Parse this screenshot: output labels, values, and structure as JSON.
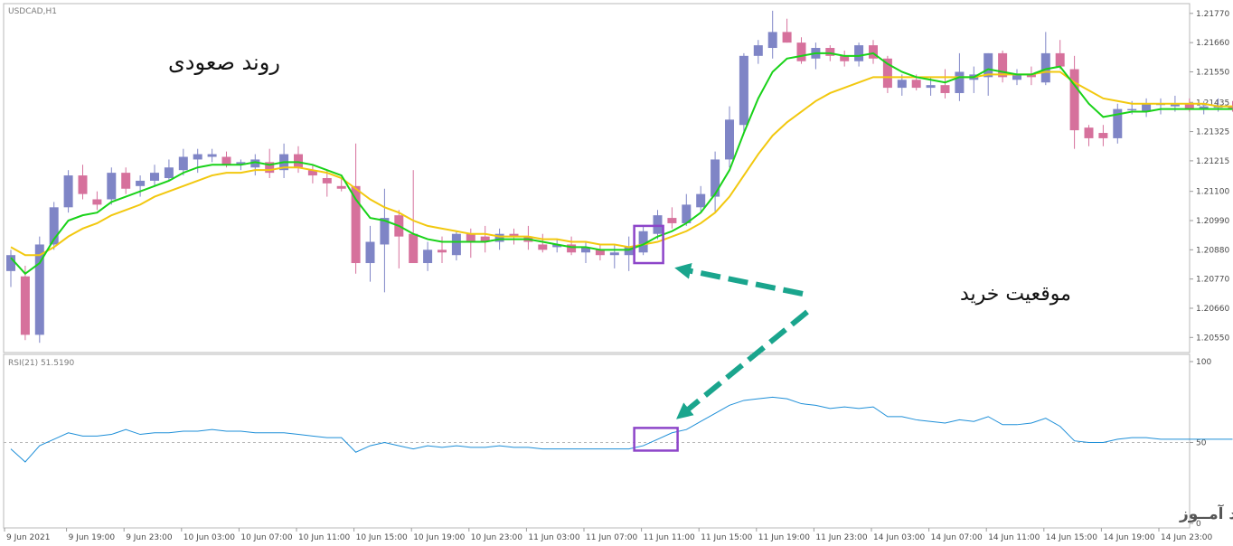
{
  "main_chart": {
    "symbol_label": "USDCAD,H1",
    "price_ticks": [
      "1.21770",
      "1.21660",
      "1.21550",
      "1.21435",
      "1.21325",
      "1.21215",
      "1.21100",
      "1.20990",
      "1.20880",
      "1.20770",
      "1.20660",
      "1.20550"
    ],
    "annotation_trend": "روند صعودی",
    "annotation_buy": "موقعیت خرید"
  },
  "rsi_panel": {
    "label": "RSI(21) 51.5190",
    "ticks": [
      "100",
      "50",
      "0"
    ]
  },
  "time_ticks": [
    "9 Jun 2021",
    "9 Jun 19:00",
    "9 Jun 23:00",
    "10 Jun 03:00",
    "10 Jun 07:00",
    "10 Jun 11:00",
    "10 Jun 15:00",
    "10 Jun 19:00",
    "10 Jun 23:00",
    "11 Jun 03:00",
    "11 Jun 07:00",
    "11 Jun 11:00",
    "11 Jun 15:00",
    "11 Jun 19:00",
    "11 Jun 23:00",
    "14 Jun 03:00",
    "14 Jun 07:00",
    "14 Jun 11:00",
    "14 Jun 15:00",
    "14 Jun 19:00",
    "14 Jun 23:00"
  ],
  "watermark": "انتشار در وبسایت ســود آمــوز",
  "colors": {
    "bull": "#7f85c6",
    "bear": "#d6719c",
    "ma_fast": "#19d219",
    "ma_slow": "#f2c80f",
    "rsi": "#1e8fd8",
    "highlight": "#8d45c9",
    "arrow": "#1aa58d"
  },
  "chart_data": {
    "type": "candlestick",
    "symbol": "USDCAD",
    "timeframe": "H1",
    "ylim": [
      1.205,
      1.218
    ],
    "candles": [
      {
        "o": 1.208,
        "h": 1.2088,
        "l": 1.2074,
        "c": 1.2086
      },
      {
        "o": 1.2078,
        "h": 1.2082,
        "l": 1.2054,
        "c": 1.2056
      },
      {
        "o": 1.2056,
        "h": 1.2093,
        "l": 1.2053,
        "c": 1.209
      },
      {
        "o": 1.209,
        "h": 1.2106,
        "l": 1.2088,
        "c": 1.2104
      },
      {
        "o": 1.2104,
        "h": 1.2118,
        "l": 1.2102,
        "c": 1.2116
      },
      {
        "o": 1.2116,
        "h": 1.212,
        "l": 1.2107,
        "c": 1.2109
      },
      {
        "o": 1.2107,
        "h": 1.211,
        "l": 1.2103,
        "c": 1.2105
      },
      {
        "o": 1.2107,
        "h": 1.2119,
        "l": 1.2105,
        "c": 1.2117
      },
      {
        "o": 1.2117,
        "h": 1.2119,
        "l": 1.2109,
        "c": 1.2111
      },
      {
        "o": 1.2112,
        "h": 1.2116,
        "l": 1.2108,
        "c": 1.2114
      },
      {
        "o": 1.2114,
        "h": 1.212,
        "l": 1.2112,
        "c": 1.2117
      },
      {
        "o": 1.2115,
        "h": 1.2122,
        "l": 1.2114,
        "c": 1.2119
      },
      {
        "o": 1.2118,
        "h": 1.2126,
        "l": 1.2116,
        "c": 1.2123
      },
      {
        "o": 1.2122,
        "h": 1.2126,
        "l": 1.2117,
        "c": 1.2124
      },
      {
        "o": 1.2123,
        "h": 1.2126,
        "l": 1.2121,
        "c": 1.2124
      },
      {
        "o": 1.2123,
        "h": 1.2125,
        "l": 1.2119,
        "c": 1.212
      },
      {
        "o": 1.212,
        "h": 1.2122,
        "l": 1.2118,
        "c": 1.2121
      },
      {
        "o": 1.2119,
        "h": 1.2124,
        "l": 1.2116,
        "c": 1.2122
      },
      {
        "o": 1.2121,
        "h": 1.2126,
        "l": 1.2115,
        "c": 1.2117
      },
      {
        "o": 1.2118,
        "h": 1.2128,
        "l": 1.2115,
        "c": 1.2124
      },
      {
        "o": 1.2124,
        "h": 1.2127,
        "l": 1.2117,
        "c": 1.2119
      },
      {
        "o": 1.2118,
        "h": 1.212,
        "l": 1.2113,
        "c": 1.2116
      },
      {
        "o": 1.2115,
        "h": 1.2118,
        "l": 1.2108,
        "c": 1.2113
      },
      {
        "o": 1.2112,
        "h": 1.2115,
        "l": 1.211,
        "c": 1.2111
      },
      {
        "o": 1.2112,
        "h": 1.2128,
        "l": 1.2079,
        "c": 1.2083
      },
      {
        "o": 1.2083,
        "h": 1.2097,
        "l": 1.2076,
        "c": 1.2091
      },
      {
        "o": 1.209,
        "h": 1.2111,
        "l": 1.2072,
        "c": 1.21
      },
      {
        "o": 1.2101,
        "h": 1.2103,
        "l": 1.2081,
        "c": 1.2093
      },
      {
        "o": 1.2094,
        "h": 1.2118,
        "l": 1.2085,
        "c": 1.2083
      },
      {
        "o": 1.2083,
        "h": 1.2091,
        "l": 1.208,
        "c": 1.2088
      },
      {
        "o": 1.2088,
        "h": 1.2093,
        "l": 1.2083,
        "c": 1.2087
      },
      {
        "o": 1.2086,
        "h": 1.2095,
        "l": 1.2084,
        "c": 1.2094
      },
      {
        "o": 1.2094,
        "h": 1.2096,
        "l": 1.2085,
        "c": 1.2091
      },
      {
        "o": 1.2093,
        "h": 1.2097,
        "l": 1.2087,
        "c": 1.2091
      },
      {
        "o": 1.2091,
        "h": 1.2096,
        "l": 1.2088,
        "c": 1.2094
      },
      {
        "o": 1.2094,
        "h": 1.2096,
        "l": 1.209,
        "c": 1.2093
      },
      {
        "o": 1.2093,
        "h": 1.2097,
        "l": 1.2088,
        "c": 1.2091
      },
      {
        "o": 1.209,
        "h": 1.2094,
        "l": 1.2087,
        "c": 1.2088
      },
      {
        "o": 1.2089,
        "h": 1.2092,
        "l": 1.2087,
        "c": 1.209
      },
      {
        "o": 1.209,
        "h": 1.2093,
        "l": 1.2086,
        "c": 1.2087
      },
      {
        "o": 1.2087,
        "h": 1.2091,
        "l": 1.2083,
        "c": 1.2089
      },
      {
        "o": 1.2088,
        "h": 1.209,
        "l": 1.2084,
        "c": 1.2086
      },
      {
        "o": 1.2086,
        "h": 1.209,
        "l": 1.2081,
        "c": 1.2087
      },
      {
        "o": 1.2086,
        "h": 1.2093,
        "l": 1.208,
        "c": 1.2089
      },
      {
        "o": 1.2087,
        "h": 1.2097,
        "l": 1.2086,
        "c": 1.2095
      },
      {
        "o": 1.2094,
        "h": 1.2103,
        "l": 1.2092,
        "c": 1.2101
      },
      {
        "o": 1.21,
        "h": 1.2104,
        "l": 1.2096,
        "c": 1.2098
      },
      {
        "o": 1.2098,
        "h": 1.2109,
        "l": 1.2097,
        "c": 1.2105
      },
      {
        "o": 1.2104,
        "h": 1.2112,
        "l": 1.2102,
        "c": 1.2109
      },
      {
        "o": 1.2108,
        "h": 1.2125,
        "l": 1.2102,
        "c": 1.2122
      },
      {
        "o": 1.2122,
        "h": 1.2142,
        "l": 1.2119,
        "c": 1.2137
      },
      {
        "o": 1.2135,
        "h": 1.2162,
        "l": 1.2132,
        "c": 1.2161
      },
      {
        "o": 1.2161,
        "h": 1.2167,
        "l": 1.2158,
        "c": 1.2165
      },
      {
        "o": 1.2164,
        "h": 1.2178,
        "l": 1.216,
        "c": 1.217
      },
      {
        "o": 1.217,
        "h": 1.2175,
        "l": 1.2166,
        "c": 1.2166
      },
      {
        "o": 1.2166,
        "h": 1.2168,
        "l": 1.2158,
        "c": 1.2159
      },
      {
        "o": 1.216,
        "h": 1.2166,
        "l": 1.2156,
        "c": 1.2164
      },
      {
        "o": 1.2164,
        "h": 1.2165,
        "l": 1.2159,
        "c": 1.2161
      },
      {
        "o": 1.2161,
        "h": 1.2163,
        "l": 1.2157,
        "c": 1.2159
      },
      {
        "o": 1.2159,
        "h": 1.2166,
        "l": 1.2157,
        "c": 1.2165
      },
      {
        "o": 1.2165,
        "h": 1.2167,
        "l": 1.2158,
        "c": 1.216
      },
      {
        "o": 1.216,
        "h": 1.2161,
        "l": 1.2147,
        "c": 1.2149
      },
      {
        "o": 1.2149,
        "h": 1.2154,
        "l": 1.2146,
        "c": 1.2152
      },
      {
        "o": 1.2152,
        "h": 1.2154,
        "l": 1.2148,
        "c": 1.2149
      },
      {
        "o": 1.2149,
        "h": 1.2153,
        "l": 1.2146,
        "c": 1.215
      },
      {
        "o": 1.215,
        "h": 1.2156,
        "l": 1.2145,
        "c": 1.2147
      },
      {
        "o": 1.2147,
        "h": 1.2162,
        "l": 1.2144,
        "c": 1.2155
      },
      {
        "o": 1.2152,
        "h": 1.2157,
        "l": 1.2147,
        "c": 1.2154
      },
      {
        "o": 1.2153,
        "h": 1.2162,
        "l": 1.2146,
        "c": 1.2162
      },
      {
        "o": 1.2162,
        "h": 1.2163,
        "l": 1.2151,
        "c": 1.2153
      },
      {
        "o": 1.2152,
        "h": 1.2156,
        "l": 1.215,
        "c": 1.2154
      },
      {
        "o": 1.2154,
        "h": 1.2157,
        "l": 1.215,
        "c": 1.2153
      },
      {
        "o": 1.2151,
        "h": 1.217,
        "l": 1.215,
        "c": 1.2162
      },
      {
        "o": 1.2162,
        "h": 1.2167,
        "l": 1.2156,
        "c": 1.2157
      },
      {
        "o": 1.2156,
        "h": 1.2161,
        "l": 1.2126,
        "c": 1.2133
      },
      {
        "o": 1.2134,
        "h": 1.2135,
        "l": 1.2127,
        "c": 1.213
      },
      {
        "o": 1.2132,
        "h": 1.2135,
        "l": 1.2127,
        "c": 1.213
      },
      {
        "o": 1.213,
        "h": 1.2143,
        "l": 1.2128,
        "c": 1.2141
      },
      {
        "o": 1.2141,
        "h": 1.2144,
        "l": 1.2139,
        "c": 1.2141
      },
      {
        "o": 1.214,
        "h": 1.2145,
        "l": 1.2138,
        "c": 1.2143
      },
      {
        "o": 1.2143,
        "h": 1.2145,
        "l": 1.2139,
        "c": 1.2143
      },
      {
        "o": 1.2142,
        "h": 1.2146,
        "l": 1.214,
        "c": 1.2143
      },
      {
        "o": 1.2143,
        "h": 1.2145,
        "l": 1.214,
        "c": 1.2141
      },
      {
        "o": 1.2141,
        "h": 1.2144,
        "l": 1.2139,
        "c": 1.2142
      },
      {
        "o": 1.2142,
        "h": 1.2145,
        "l": 1.214,
        "c": 1.2142
      },
      {
        "o": 1.2142,
        "h": 1.2144,
        "l": 1.214,
        "c": 1.2141
      }
    ],
    "ma_fast": [
      1.2085,
      1.2079,
      1.2083,
      1.2092,
      1.2099,
      1.2101,
      1.2102,
      1.2106,
      1.2108,
      1.211,
      1.2112,
      1.2114,
      1.2117,
      1.2119,
      1.212,
      1.212,
      1.212,
      1.2121,
      1.212,
      1.2121,
      1.2121,
      1.212,
      1.2118,
      1.2116,
      1.2107,
      1.21,
      1.2099,
      1.2097,
      1.2094,
      1.2092,
      1.2091,
      1.2091,
      1.2091,
      1.2091,
      1.2092,
      1.2092,
      1.2092,
      1.2091,
      1.209,
      1.2089,
      1.2089,
      1.2088,
      1.2088,
      1.2088,
      1.209,
      1.2093,
      1.2095,
      1.2098,
      1.2102,
      1.2109,
      1.2118,
      1.2132,
      1.2145,
      1.2155,
      1.216,
      1.2161,
      1.2162,
      1.2162,
      1.2161,
      1.2161,
      1.2162,
      1.2158,
      1.2155,
      1.2153,
      1.2152,
      1.2151,
      1.2153,
      1.2153,
      1.2156,
      1.2155,
      1.2154,
      1.2154,
      1.2156,
      1.2157,
      1.215,
      1.2143,
      1.2138,
      1.2139,
      1.214,
      1.214,
      1.2141,
      1.2141,
      1.2141,
      1.2141,
      1.2141,
      1.2141
    ],
    "ma_slow": [
      1.2089,
      1.2086,
      1.2086,
      1.2089,
      1.2093,
      1.2096,
      1.2098,
      1.2101,
      1.2103,
      1.2105,
      1.2108,
      1.211,
      1.2112,
      1.2114,
      1.2116,
      1.2117,
      1.2117,
      1.2118,
      1.2118,
      1.2119,
      1.2119,
      1.2118,
      1.2117,
      1.2115,
      1.2111,
      1.2107,
      1.2104,
      1.2102,
      1.2099,
      1.2097,
      1.2096,
      1.2095,
      1.2094,
      1.2094,
      1.2093,
      1.2093,
      1.2093,
      1.2092,
      1.2092,
      1.2091,
      1.2091,
      1.209,
      1.209,
      1.2089,
      1.209,
      1.2091,
      1.2093,
      1.2095,
      1.2098,
      1.2102,
      1.2108,
      1.2116,
      1.2124,
      1.2131,
      1.2136,
      1.214,
      1.2144,
      1.2147,
      1.2149,
      1.2151,
      1.2153,
      1.2153,
      1.2153,
      1.2153,
      1.2153,
      1.2153,
      1.2153,
      1.2153,
      1.2154,
      1.2154,
      1.2154,
      1.2154,
      1.2155,
      1.2155,
      1.2151,
      1.2148,
      1.2145,
      1.2144,
      1.2143,
      1.2143,
      1.2143,
      1.2143,
      1.2143,
      1.2143,
      1.2142,
      1.2142
    ],
    "rsi": [
      46,
      38,
      48,
      52,
      56,
      54,
      54,
      55,
      58,
      55,
      56,
      56,
      57,
      57,
      58,
      57,
      57,
      56,
      56,
      56,
      55,
      54,
      53,
      53,
      44,
      48,
      50,
      48,
      46,
      48,
      47,
      48,
      47,
      47,
      48,
      47,
      47,
      46,
      46,
      46,
      46,
      46,
      46,
      46,
      48,
      52,
      56,
      58,
      63,
      68,
      73,
      76,
      77,
      78,
      77,
      74,
      73,
      71,
      72,
      71,
      72,
      66,
      66,
      64,
      63,
      62,
      64,
      63,
      66,
      61,
      61,
      62,
      65,
      60,
      51,
      50,
      50,
      52,
      53,
      53,
      52,
      52,
      52,
      52,
      52,
      52
    ],
    "rsi_ylim": [
      0,
      100
    ],
    "rsi_level": 50,
    "buy_index": 44
  }
}
